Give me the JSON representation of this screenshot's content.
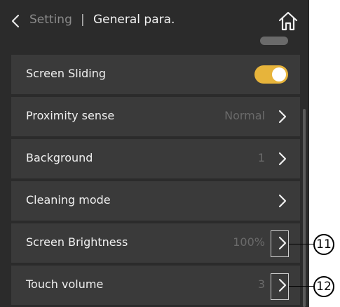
{
  "header": {
    "back_label": "Setting",
    "separator": "|",
    "title": "General para."
  },
  "rows": [
    {
      "label": "Screen Sliding",
      "value": "",
      "control": "toggle",
      "toggle_on": true
    },
    {
      "label": "Proximity sense",
      "value": "Normal",
      "control": "chevron"
    },
    {
      "label": "Background",
      "value": "1",
      "control": "chevron"
    },
    {
      "label": "Cleaning mode",
      "value": "",
      "control": "chevron"
    },
    {
      "label": "Screen Brightness",
      "value": "100%",
      "control": "chevron"
    },
    {
      "label": "Touch volume",
      "value": "3",
      "control": "chevron"
    }
  ],
  "callouts": {
    "brightness": "11",
    "volume": "12"
  },
  "colors": {
    "background": "#2b2b2b",
    "row": "#3a3a3a",
    "accent": "#e7b43b"
  }
}
